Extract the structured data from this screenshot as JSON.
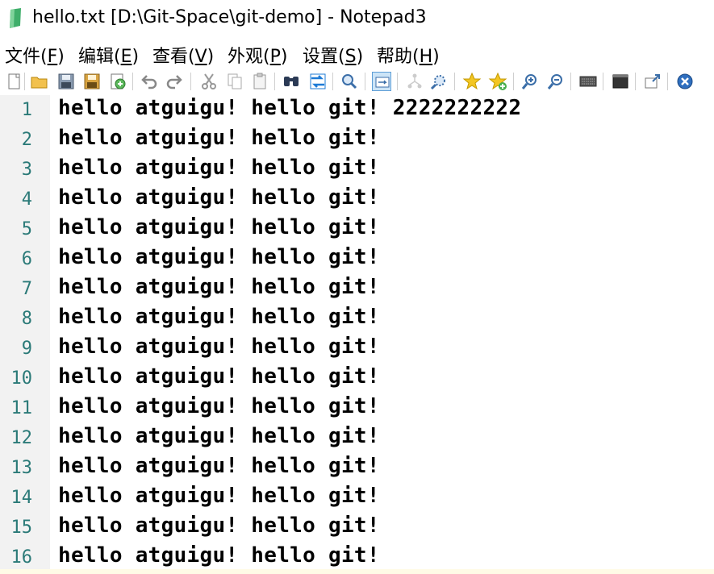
{
  "window": {
    "title": "hello.txt [D:\\Git-Space\\git-demo] - Notepad3",
    "app_icon": "notepad3-icon"
  },
  "menu": [
    {
      "pre": "文件(",
      "acc": "F",
      "post": ")"
    },
    {
      "pre": "编辑(",
      "acc": "E",
      "post": ")"
    },
    {
      "pre": "查看(",
      "acc": "V",
      "post": ")"
    },
    {
      "pre": "外观(",
      "acc": "P",
      "post": ")"
    },
    {
      "pre": "设置(",
      "acc": "S",
      "post": ")"
    },
    {
      "pre": "帮助(",
      "acc": "H",
      "post": ")"
    }
  ],
  "toolbar": {
    "buttons": [
      "new-file-icon",
      "open-folder-icon",
      "save-icon",
      "save-as-icon",
      "revert-icon",
      "undo-icon",
      "redo-icon",
      "cut-icon",
      "copy-icon",
      "paste-icon",
      "find-icon",
      "replace-icon",
      "find-next-icon",
      "word-wrap-icon",
      "bookmark-tree-icon",
      "select-all-icon",
      "bookmark-star-icon",
      "add-bookmark-icon",
      "zoom-in-icon",
      "zoom-out-icon",
      "keyboard-icon",
      "console-icon",
      "pin-icon",
      "close-icon"
    ],
    "active": "word-wrap-icon"
  },
  "editor": {
    "lines": [
      {
        "n": "1",
        "text": "hello atguigu! hello git! 2222222222"
      },
      {
        "n": "2",
        "text": "hello atguigu! hello git!"
      },
      {
        "n": "3",
        "text": "hello atguigu! hello git!"
      },
      {
        "n": "4",
        "text": "hello atguigu! hello git!"
      },
      {
        "n": "5",
        "text": "hello atguigu! hello git!"
      },
      {
        "n": "6",
        "text": "hello atguigu! hello git!"
      },
      {
        "n": "7",
        "text": "hello atguigu! hello git!"
      },
      {
        "n": "8",
        "text": "hello atguigu! hello git!"
      },
      {
        "n": "9",
        "text": "hello atguigu! hello git!"
      },
      {
        "n": "10",
        "text": "hello atguigu! hello git!"
      },
      {
        "n": "11",
        "text": "hello atguigu! hello git!"
      },
      {
        "n": "12",
        "text": "hello atguigu! hello git!"
      },
      {
        "n": "13",
        "text": "hello atguigu! hello git!"
      },
      {
        "n": "14",
        "text": "hello atguigu! hello git!"
      },
      {
        "n": "15",
        "text": "hello atguigu! hello git!"
      },
      {
        "n": "16",
        "text": "hello atguigu! hello git!"
      }
    ]
  }
}
